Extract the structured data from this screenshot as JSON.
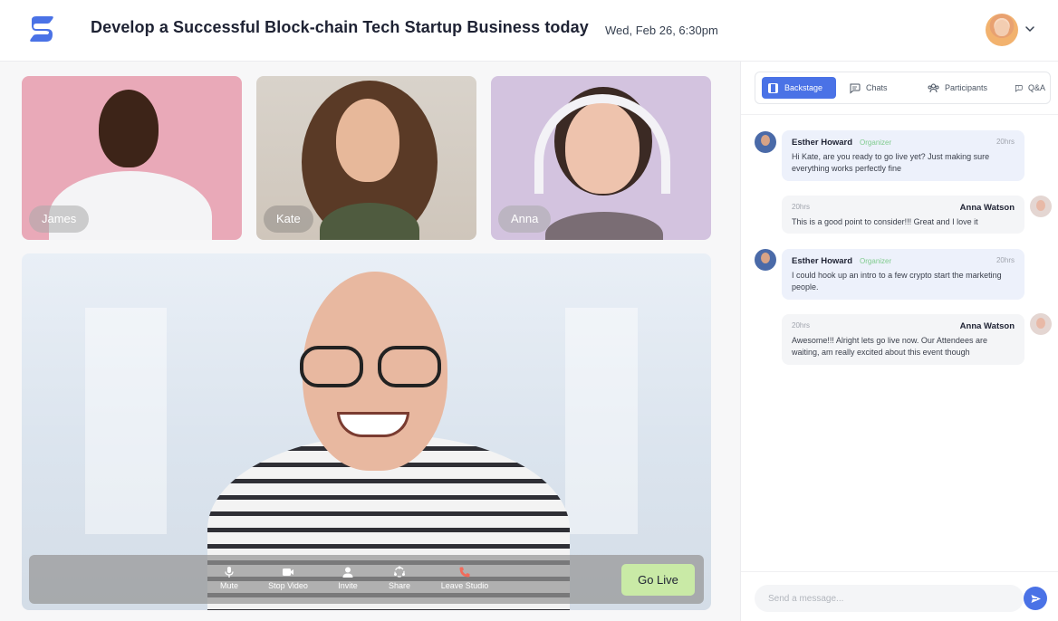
{
  "header": {
    "title": "Develop a Successful Block-chain Tech Startup Business today",
    "datetime": "Wed, Feb 26,  6:30pm",
    "brand_color": "#4a72e6"
  },
  "participants": [
    {
      "name": "James",
      "bg": "#e9a9b8"
    },
    {
      "name": "Kate",
      "bg": "#d9d3cb"
    },
    {
      "name": "Anna",
      "bg": "#d3c3df"
    }
  ],
  "controls": {
    "mute": "Mute",
    "stop_video": "Stop Video",
    "invite": "Invite",
    "share": "Share",
    "leave": "Leave Studio",
    "go_live": "Go Live",
    "leave_color": "#f26b5b",
    "go_live_color": "#c9eaa6"
  },
  "tabs": [
    {
      "label": "Backstage",
      "active": true
    },
    {
      "label": "Chats",
      "active": false
    },
    {
      "label": "Participants",
      "active": false
    },
    {
      "label": "Q&A",
      "active": false
    }
  ],
  "messages": [
    {
      "sender": "Esther Howard",
      "role": "Organizer",
      "time": "20hrs",
      "text": "Hi Kate, are you ready to go live yet? Just making sure everything works perfectly fine",
      "side": "left"
    },
    {
      "sender": "Anna Watson",
      "role": "",
      "time": "20hrs",
      "text": "This is a good point to consider!!! Great and I love it",
      "side": "right"
    },
    {
      "sender": "Esther Howard",
      "role": "Organizer",
      "time": "20hrs",
      "text": "I could hook up an intro to a few crypto start the marketing people.",
      "side": "left"
    },
    {
      "sender": "Anna Watson",
      "role": "",
      "time": "20hrs",
      "text": "Awesome!!! Alright lets go live now. Our Attendees are waiting, am really excited about this event though",
      "side": "right"
    }
  ],
  "composer": {
    "placeholder": "Send a message..."
  }
}
